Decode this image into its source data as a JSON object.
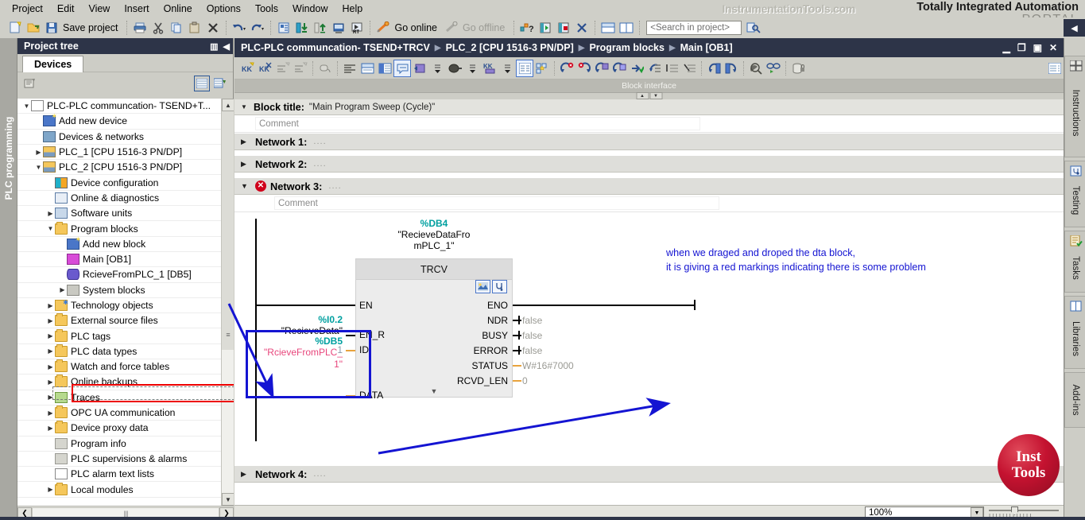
{
  "menu": {
    "items": [
      "Project",
      "Edit",
      "View",
      "Insert",
      "Online",
      "Options",
      "Tools",
      "Window",
      "Help"
    ]
  },
  "watermark": "InstrumentationTools.com",
  "brand": {
    "line1": "Totally Integrated Automation",
    "line2": "PORTAL"
  },
  "toolbar": {
    "save_label": "Save project",
    "go_online_label": "Go online",
    "go_offline_label": "Go offline",
    "search_placeholder": "<Search in project>",
    "icons": {
      "new_project": "new-project-icon",
      "open_project": "open-project-icon",
      "save": "save-icon",
      "print": "print-icon",
      "cut": "cut-icon",
      "copy": "copy-icon",
      "paste": "paste-icon",
      "delete": "delete-icon",
      "undo": "undo-icon",
      "redo": "redo-icon",
      "compile": "compile-icon",
      "download": "download-to-device-icon",
      "upload": "upload-from-device-icon",
      "start_sim": "start-simulation-icon",
      "start_rt": "start-runtime-icon",
      "go_online": "go-online-icon",
      "go_offline": "go-offline-icon",
      "diagnostics": "diagnostics-icon",
      "start_cpu": "start-cpu-icon",
      "stop_cpu": "stop-cpu-icon",
      "close_view": "close-view-icon",
      "split_horizontal": "split-editor-horizontal-icon",
      "split_vertical": "split-editor-vertical-icon",
      "search_go": "search-go-icon"
    }
  },
  "left_vertical_tab": "PLC programming",
  "project_tree": {
    "title": "Project tree",
    "tab": "Devices",
    "items": [
      {
        "label": "PLC-PLC communcation- TSEND+T...",
        "depth": 0,
        "twisty": "down",
        "icon": "project-icon"
      },
      {
        "label": "Add new device",
        "depth": 1,
        "twisty": "none",
        "icon": "add-new-device-icon"
      },
      {
        "label": "Devices & networks",
        "depth": 1,
        "twisty": "none",
        "icon": "devices-networks-icon"
      },
      {
        "label": "PLC_1 [CPU 1516-3 PN/DP]",
        "depth": 1,
        "twisty": "right",
        "icon": "plc-icon"
      },
      {
        "label": "PLC_2 [CPU 1516-3 PN/DP]",
        "depth": 1,
        "twisty": "down",
        "icon": "plc-icon"
      },
      {
        "label": "Device configuration",
        "depth": 2,
        "twisty": "none",
        "icon": "device-configuration-icon"
      },
      {
        "label": "Online & diagnostics",
        "depth": 2,
        "twisty": "none",
        "icon": "online-diagnostics-icon"
      },
      {
        "label": "Software units",
        "depth": 2,
        "twisty": "right",
        "icon": "software-units-icon"
      },
      {
        "label": "Program blocks",
        "depth": 2,
        "twisty": "down",
        "icon": "program-blocks-icon"
      },
      {
        "label": "Add new block",
        "depth": 3,
        "twisty": "none",
        "icon": "add-new-block-icon"
      },
      {
        "label": "Main [OB1]",
        "depth": 3,
        "twisty": "none",
        "icon": "ob-block-icon"
      },
      {
        "label": "RcieveFromPLC_1 [DB5]",
        "depth": 3,
        "twisty": "none",
        "icon": "db-block-icon",
        "highlighted": true
      },
      {
        "label": "System blocks",
        "depth": 3,
        "twisty": "right",
        "icon": "system-blocks-icon"
      },
      {
        "label": "Technology objects",
        "depth": 2,
        "twisty": "right",
        "icon": "technology-objects-icon"
      },
      {
        "label": "External source files",
        "depth": 2,
        "twisty": "right",
        "icon": "external-source-files-icon"
      },
      {
        "label": "PLC tags",
        "depth": 2,
        "twisty": "right",
        "icon": "plc-tags-icon"
      },
      {
        "label": "PLC data types",
        "depth": 2,
        "twisty": "right",
        "icon": "plc-data-types-icon"
      },
      {
        "label": "Watch and force tables",
        "depth": 2,
        "twisty": "right",
        "icon": "watch-force-tables-icon"
      },
      {
        "label": "Online backups",
        "depth": 2,
        "twisty": "right",
        "icon": "online-backups-icon"
      },
      {
        "label": "Traces",
        "depth": 2,
        "twisty": "right",
        "icon": "traces-icon"
      },
      {
        "label": "OPC UA communication",
        "depth": 2,
        "twisty": "right",
        "icon": "opc-ua-icon"
      },
      {
        "label": "Device proxy data",
        "depth": 2,
        "twisty": "right",
        "icon": "device-proxy-data-icon"
      },
      {
        "label": "Program info",
        "depth": 2,
        "twisty": "none",
        "icon": "program-info-icon"
      },
      {
        "label": "PLC supervisions & alarms",
        "depth": 2,
        "twisty": "none",
        "icon": "plc-supervisions-alarms-icon"
      },
      {
        "label": "PLC alarm text lists",
        "depth": 2,
        "twisty": "none",
        "icon": "plc-alarm-text-lists-icon"
      },
      {
        "label": "Local modules",
        "depth": 2,
        "twisty": "right",
        "icon": "local-modules-icon"
      }
    ]
  },
  "editor": {
    "breadcrumb": [
      "PLC-PLC communcation- TSEND+TRCV",
      "PLC_2 [CPU 1516-3 PN/DP]",
      "Program blocks",
      "Main [OB1]"
    ],
    "block_interface_label": "Block interface",
    "block_title_label": "Block title:",
    "block_title_value": "\"Main Program Sweep (Cycle)\"",
    "comment_placeholder": "Comment",
    "networks": [
      {
        "label": "Network 1:",
        "dots": "....",
        "state": "collapsed",
        "error": false
      },
      {
        "label": "Network 2:",
        "dots": "....",
        "state": "collapsed",
        "error": false
      },
      {
        "label": "Network 3:",
        "dots": "....",
        "state": "expanded",
        "error": true
      },
      {
        "label": "Network 4:",
        "dots": "....",
        "state": "collapsed",
        "error": false
      }
    ],
    "zoom_value": "100%"
  },
  "lad": {
    "instance_db_number": "%DB4",
    "instance_db_name_l1": "\"RecieveDataFro",
    "instance_db_name_l2": "mPLC_1\"",
    "block_name": "TRCV",
    "inputs": [
      {
        "pin": "EN",
        "tag": "",
        "addr": "",
        "wire": "black"
      },
      {
        "pin": "EN_R",
        "tag": "\"RecieveData\"",
        "addr": "%I0.2",
        "wire": "black"
      },
      {
        "pin": "ID",
        "tag": "1",
        "addr": "",
        "wire": "orange"
      },
      {
        "pin": "DATA",
        "tag": "\"RcieveFromPLC_\n1\"",
        "addr": "%DB5",
        "wire": "orange"
      }
    ],
    "outputs": [
      {
        "pin": "ENO",
        "value": "",
        "wire": "black"
      },
      {
        "pin": "NDR",
        "value": "false",
        "wire": "black"
      },
      {
        "pin": "BUSY",
        "value": "false",
        "wire": "black"
      },
      {
        "pin": "ERROR",
        "value": "false",
        "wire": "black"
      },
      {
        "pin": "STATUS",
        "value": "W#16#7000",
        "wire": "orange"
      },
      {
        "pin": "RCVD_LEN",
        "value": "0",
        "wire": "orange"
      }
    ],
    "data_input": {
      "db_number": "%DB5",
      "name_l1": "\"RcieveFromPLC_",
      "name_l2": "1\""
    },
    "annotation_line1": "when we draged and droped the dta block,",
    "annotation_line2": "it is giving a red markings indicating there is some problem"
  },
  "right_tabs": [
    {
      "label": "Instructions",
      "icon": "instructions-icon"
    },
    {
      "label": "Testing",
      "icon": "testing-icon"
    },
    {
      "label": "Tasks",
      "icon": "tasks-icon"
    },
    {
      "label": "Libraries",
      "icon": "libraries-icon"
    },
    {
      "label": "Add-ins",
      "icon": "add-ins-icon"
    }
  ],
  "logo": {
    "line1": "Inst",
    "line2": "Tools"
  },
  "colors": {
    "titlebar": "#2d3448",
    "accent_cyan": "#00a0a0",
    "accent_pink": "#e8467c",
    "accent_orange": "#e8a33d",
    "error_red": "#d0021b",
    "annotation_blue": "#1414d2",
    "highlight_red": "#ee0000"
  }
}
